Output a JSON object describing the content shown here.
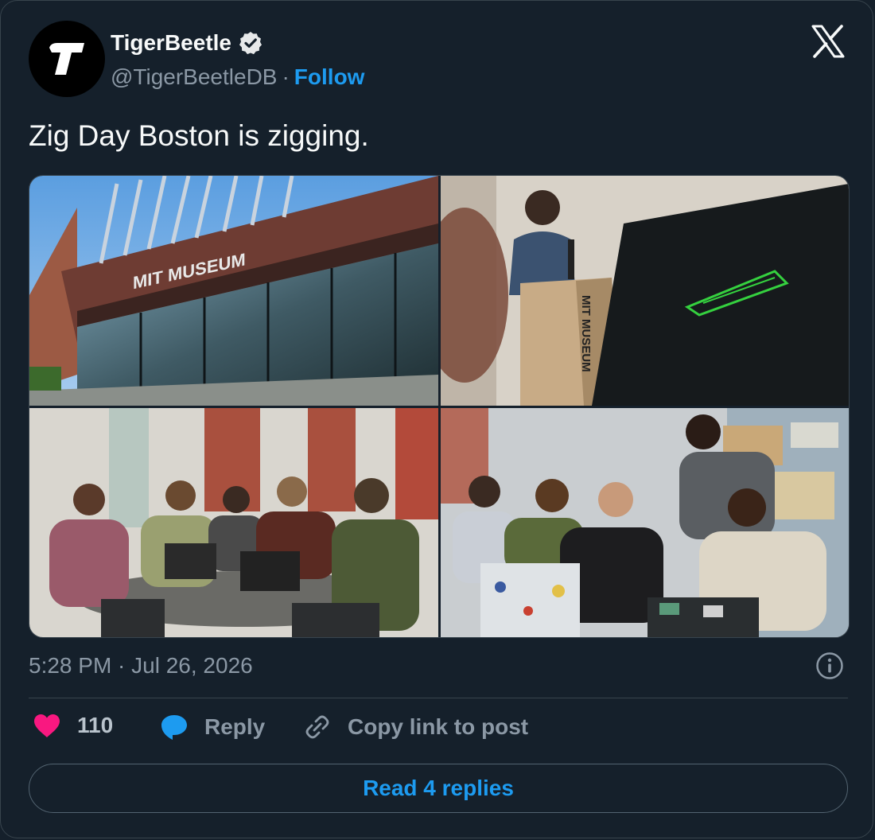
{
  "author": {
    "name": "TigerBeetle",
    "handle": "@TigerBeetleDB",
    "separator": "·",
    "follow_label": "Follow",
    "avatar_letter": "T",
    "verified": true
  },
  "tweet": {
    "text": "Zig Day Boston is zigging.",
    "timestamp": "5:28 PM · Jul 26, 2026"
  },
  "media": {
    "photos": [
      {
        "name": "mit-museum-exterior",
        "sign_text": "MIT MUSEUM"
      },
      {
        "name": "speaker-at-podium",
        "podium_text": "MIT MUSEUM"
      },
      {
        "name": "attendees-round-table"
      },
      {
        "name": "attendees-laptops"
      }
    ]
  },
  "actions": {
    "like_count": "110",
    "reply_label": "Reply",
    "copy_label": "Copy link to post"
  },
  "read_replies_label": "Read 4 replies",
  "icons": {
    "brand": "x-logo-icon",
    "verified": "verified-badge-icon",
    "info": "info-icon",
    "like": "heart-icon",
    "reply": "speech-bubble-icon",
    "copy": "link-icon"
  },
  "colors": {
    "background": "#15202b",
    "accent": "#1d9bf0",
    "like": "#f91880",
    "muted": "#8b98a5",
    "border": "#38444d"
  }
}
